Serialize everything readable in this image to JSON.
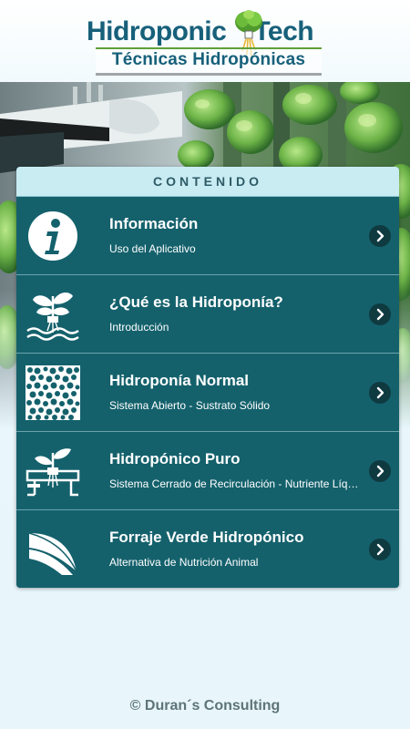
{
  "header": {
    "logo_word1": "Hidroponic",
    "logo_word2": "Tech",
    "logo_subtitle": "Técnicas Hidropónicas"
  },
  "panel": {
    "heading": "CONTENIDO",
    "items": [
      {
        "title": "Información",
        "subtitle": "Uso del Aplicativo",
        "icon": "info-icon"
      },
      {
        "title": "¿Qué es la Hidroponía?",
        "subtitle": "Introducción",
        "icon": "seedling-water-icon"
      },
      {
        "title": "Hidroponía Normal",
        "subtitle": "Sistema Abierto - Sustrato Sólido",
        "icon": "substrate-icon"
      },
      {
        "title": "Hidropónico Puro",
        "subtitle": "Sistema Cerrado de Recirculación - Nutriente Líquido",
        "icon": "plant-channel-icon"
      },
      {
        "title": "Forraje Verde Hidropónico",
        "subtitle": "Alternativa de Nutrición Animal",
        "icon": "forage-leaves-icon"
      }
    ]
  },
  "footer": {
    "text": "© Duran´s Consulting"
  },
  "colors": {
    "panel_bg": "#14616c",
    "panel_header_bg": "#c9ecf3",
    "brand_text": "#17607a",
    "chevron_bg": "#0e3a40"
  }
}
